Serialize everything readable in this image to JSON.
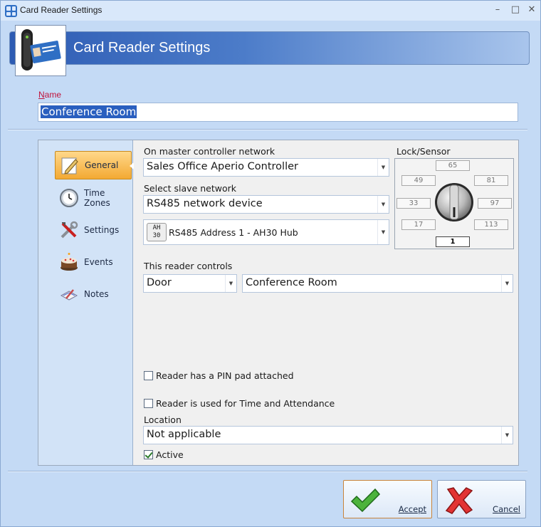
{
  "window": {
    "title": "Card Reader Settings",
    "controls": {
      "minimize": "–",
      "maximize": "□",
      "close": "✕"
    }
  },
  "header": {
    "title": "Card Reader Settings",
    "icon": "card-reader-icon"
  },
  "name_field": {
    "label_first": "N",
    "label_rest": "ame",
    "value": "Conference Room"
  },
  "sidebar": {
    "items": [
      {
        "label": "General",
        "icon": "pencil-icon",
        "active": true
      },
      {
        "label": "Time Zones",
        "icon": "clock-icon",
        "active": false
      },
      {
        "label": "Settings",
        "icon": "tools-icon",
        "active": false
      },
      {
        "label": "Events",
        "icon": "cake-icon",
        "active": false
      },
      {
        "label": "Notes",
        "icon": "notes-icon",
        "active": false
      }
    ]
  },
  "general": {
    "master_network_label": "On master controller network",
    "master_network_value": "Sales Office Aperio Controller",
    "slave_network_label": "Select slave network",
    "slave_network_value": "RS485 network device",
    "address_badge_top": "AH",
    "address_badge_bottom": "30",
    "address_value": "RS485 Address 1 - AH30 Hub",
    "controls_label": "This reader controls",
    "controls_type_value": "Door",
    "controls_target_value": "Conference Room",
    "pin_pad_label": "Reader has a PIN pad attached",
    "pin_pad_checked": false,
    "time_attendance_label": "Reader is used for Time and Attendance",
    "time_attendance_checked": false,
    "location_label": "Location",
    "location_value": "Not applicable",
    "active_label": "Active",
    "active_checked": true
  },
  "lock_sensor": {
    "label": "Lock/Sensor",
    "values": [
      "65",
      "49",
      "81",
      "33",
      "97",
      "17",
      "113",
      "1"
    ],
    "selected": "1"
  },
  "buttons": {
    "accept_first": "A",
    "accept_rest": "ccept",
    "cancel_first": "C",
    "cancel_rest": "ancel"
  },
  "colors": {
    "accept": "#3fa532",
    "cancel": "#d22626",
    "active_tab": "#f3a933",
    "banner": "#2d5bb3"
  }
}
